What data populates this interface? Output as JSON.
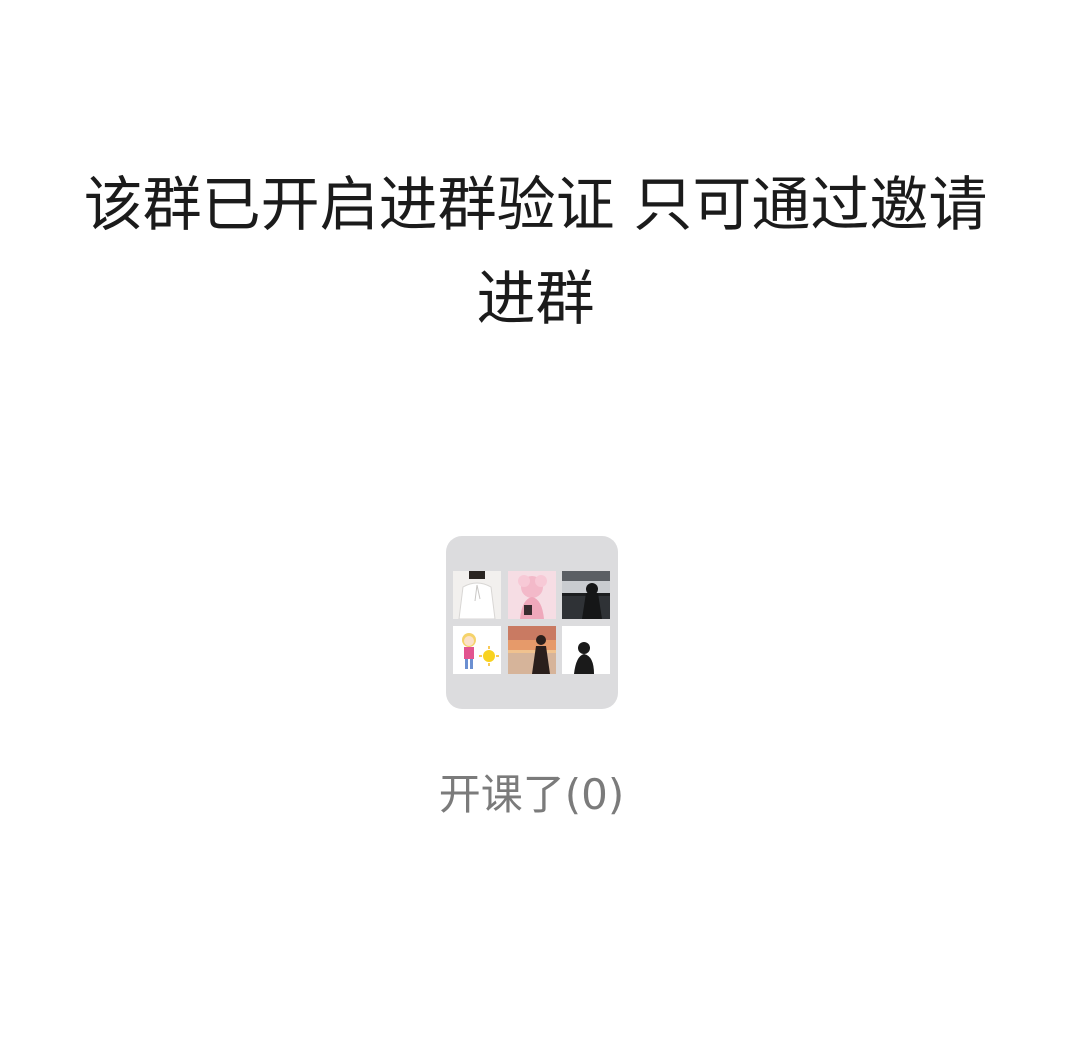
{
  "notice": {
    "line1": "该群已开启进群验证 只可通过邀请",
    "line2": "进群"
  },
  "group": {
    "name": "开课了(0)",
    "member_avatars": [
      "avatar-photo-white-shirt",
      "avatar-pink-anime",
      "avatar-photo-seaside-silhouette",
      "avatar-cartoon-girl-sun",
      "avatar-photo-sunset-figure",
      "avatar-photo-dark-figure"
    ]
  },
  "colors": {
    "background": "#ffffff",
    "notice_text": "#1b1b1b",
    "group_name_text": "#7b7b7b",
    "avatar_tile_bg": "#dcdcde"
  }
}
